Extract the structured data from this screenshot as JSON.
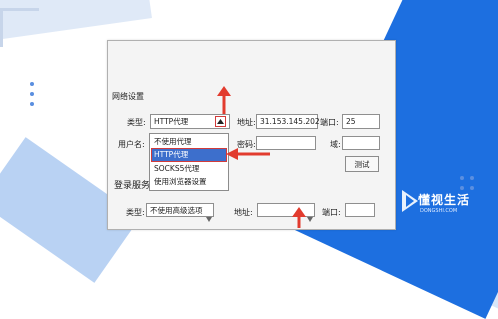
{
  "dialog": {
    "section_title": "网络设置",
    "type_label": "类型:",
    "type_value": "HTTP代理",
    "address_label": "地址:",
    "address_value": "31.153.145.202",
    "port_label": "端口:",
    "port_value": "25",
    "username_label": "用户名:",
    "password_label": "密码:",
    "domain_label": "域:",
    "test_button": "测试",
    "login_section_title": "登录服务",
    "login_type_label": "类型:",
    "login_type_value": "不使用高级选项",
    "login_address_label": "地址:",
    "login_port_label": "端口:"
  },
  "dropdown": {
    "options": [
      "不使用代理",
      "HTTP代理",
      "SOCKS5代理",
      "使用浏览器设置"
    ],
    "selected_index": 1
  },
  "watermark": {
    "text": "懂视生活",
    "sub": "DONGSHI.COM"
  },
  "colors": {
    "accent_red": "#e23b2e",
    "selected_blue": "#3d6fcc",
    "bg_blue": "#1d6fe0"
  }
}
